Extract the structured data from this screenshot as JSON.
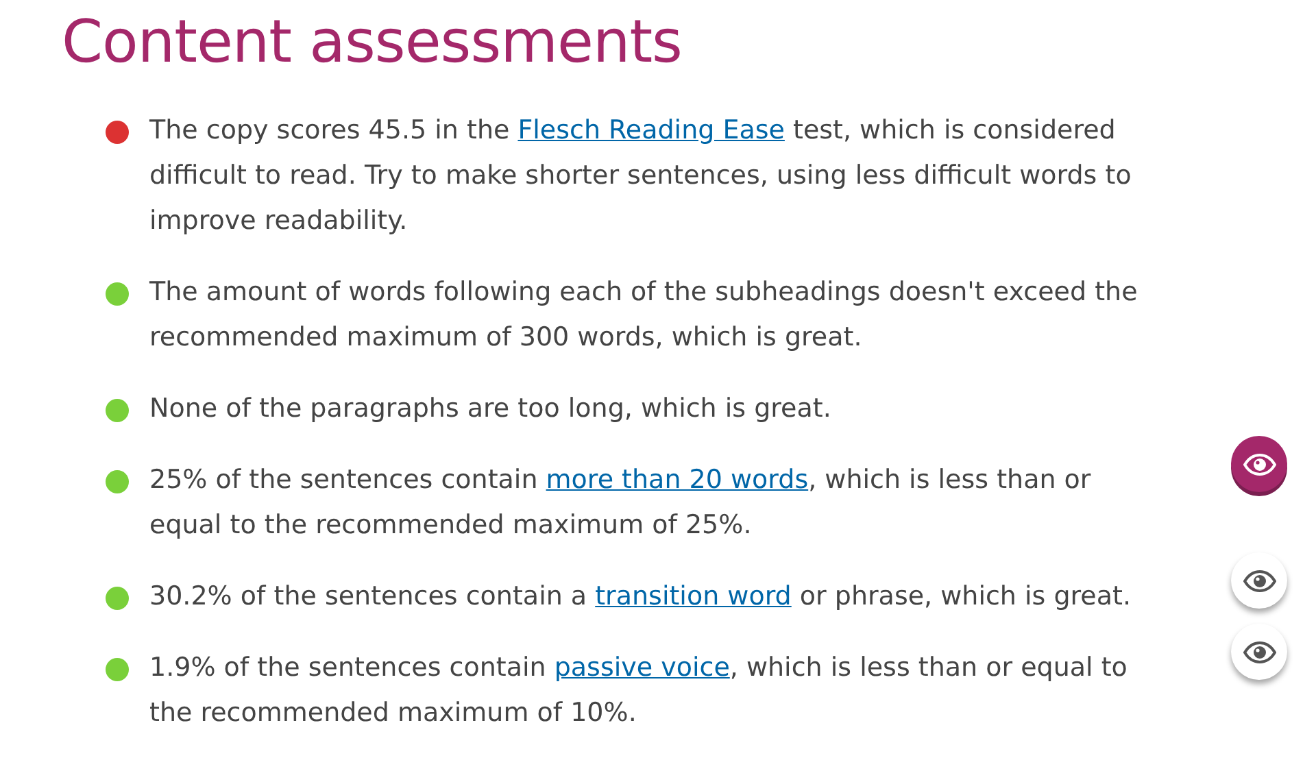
{
  "title": "Content assessments",
  "items": [
    {
      "color": "#dc3232",
      "parts": [
        {
          "text": "The copy scores 45.5 in the "
        },
        {
          "link": "Flesch Reading Ease"
        },
        {
          "text": " test, which is considered difficult to read. Try to make shorter sentences, using less difficult words to improve readability."
        }
      ]
    },
    {
      "color": "#7ad03a",
      "parts": [
        {
          "text": "The amount of words following each of the subheadings doesn't exceed the recommended maximum of 300 words, which is great."
        }
      ]
    },
    {
      "color": "#7ad03a",
      "parts": [
        {
          "text": "None of the paragraphs are too long, which is great."
        }
      ]
    },
    {
      "color": "#7ad03a",
      "parts": [
        {
          "text": "25% of the sentences contain "
        },
        {
          "link": "more than 20 words"
        },
        {
          "text": ", which is less than or equal to the recommended maximum of 25%."
        }
      ],
      "marker_button": {
        "selected": true
      }
    },
    {
      "color": "#7ad03a",
      "parts": [
        {
          "text": "30.2% of the sentences contain a "
        },
        {
          "link": "transition word"
        },
        {
          "text": " or phrase, which is great."
        }
      ],
      "marker_button": {
        "selected": false
      }
    },
    {
      "color": "#7ad03a",
      "parts": [
        {
          "text": "1.9% of the sentences contain "
        },
        {
          "link": "passive voice"
        },
        {
          "text": ", which is less than or equal to the recommended maximum of 10%."
        }
      ],
      "marker_button": {
        "selected": false
      }
    }
  ]
}
